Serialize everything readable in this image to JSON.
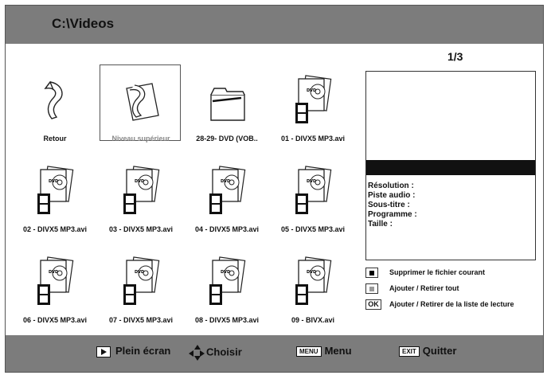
{
  "header": {
    "path": "C:\\Videos"
  },
  "grid": {
    "items": [
      {
        "label": "Retour",
        "type": "back"
      },
      {
        "label": "Niveau supérieur",
        "type": "up",
        "selected": true
      },
      {
        "label": "28-29- DVD (VOB..",
        "type": "folder"
      },
      {
        "label": "01 - DIVX5 MP3.avi",
        "type": "video"
      },
      {
        "label": "02 - DIVX5 MP3.avi",
        "type": "video"
      },
      {
        "label": "03 - DIVX5 MP3.avi",
        "type": "video"
      },
      {
        "label": "04 - DIVX5 MP3.avi",
        "type": "video"
      },
      {
        "label": "05 - DIVX5 MP3.avi",
        "type": "video"
      },
      {
        "label": "06 - DIVX5 MP3.avi",
        "type": "video"
      },
      {
        "label": "07 - DIVX5 MP3.avi",
        "type": "video"
      },
      {
        "label": "08 - DIVX5 MP3.avi",
        "type": "video"
      },
      {
        "label": "09 - BIVX.avi",
        "type": "video"
      }
    ]
  },
  "page_indicator": "1/3",
  "info": {
    "resolution": "Résolution :",
    "audio": "Piste audio :",
    "subtitle": "Sous-titre :",
    "program": "Programme :",
    "size": "Taille :"
  },
  "legend": {
    "delete": "Supprimer le fichier courant",
    "toggle_all": "Ajouter / Retirer tout",
    "ok_key": "OK",
    "toggle_playlist": "Ajouter / Retirer de la liste de lecture"
  },
  "footer": {
    "fullscreen": "Plein écran",
    "choose": "Choisir",
    "menu_key": "MENU",
    "menu": "Menu",
    "exit_key": "EXIT",
    "quit": "Quitter"
  }
}
